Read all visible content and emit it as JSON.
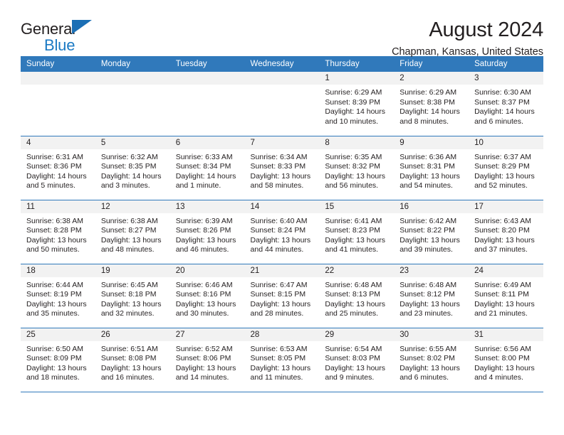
{
  "brand": {
    "line1": "General",
    "line2": "Blue",
    "flag_icon": "triangle-flag-icon",
    "accent_color": "#1b7ac4"
  },
  "header": {
    "month_title": "August 2024",
    "location": "Chapman, Kansas, United States"
  },
  "calendar": {
    "header_bg": "#3079bb",
    "daynum_bg": "#f2f2f2",
    "weekday_headers": [
      "Sunday",
      "Monday",
      "Tuesday",
      "Wednesday",
      "Thursday",
      "Friday",
      "Saturday"
    ],
    "weeks": [
      [
        {
          "day": "",
          "empty": true
        },
        {
          "day": "",
          "empty": true
        },
        {
          "day": "",
          "empty": true
        },
        {
          "day": "",
          "empty": true
        },
        {
          "day": "1",
          "sunrise": "Sunrise: 6:29 AM",
          "sunset": "Sunset: 8:39 PM",
          "daylight": "Daylight: 14 hours and 10 minutes."
        },
        {
          "day": "2",
          "sunrise": "Sunrise: 6:29 AM",
          "sunset": "Sunset: 8:38 PM",
          "daylight": "Daylight: 14 hours and 8 minutes."
        },
        {
          "day": "3",
          "sunrise": "Sunrise: 6:30 AM",
          "sunset": "Sunset: 8:37 PM",
          "daylight": "Daylight: 14 hours and 6 minutes."
        }
      ],
      [
        {
          "day": "4",
          "sunrise": "Sunrise: 6:31 AM",
          "sunset": "Sunset: 8:36 PM",
          "daylight": "Daylight: 14 hours and 5 minutes."
        },
        {
          "day": "5",
          "sunrise": "Sunrise: 6:32 AM",
          "sunset": "Sunset: 8:35 PM",
          "daylight": "Daylight: 14 hours and 3 minutes."
        },
        {
          "day": "6",
          "sunrise": "Sunrise: 6:33 AM",
          "sunset": "Sunset: 8:34 PM",
          "daylight": "Daylight: 14 hours and 1 minute."
        },
        {
          "day": "7",
          "sunrise": "Sunrise: 6:34 AM",
          "sunset": "Sunset: 8:33 PM",
          "daylight": "Daylight: 13 hours and 58 minutes."
        },
        {
          "day": "8",
          "sunrise": "Sunrise: 6:35 AM",
          "sunset": "Sunset: 8:32 PM",
          "daylight": "Daylight: 13 hours and 56 minutes."
        },
        {
          "day": "9",
          "sunrise": "Sunrise: 6:36 AM",
          "sunset": "Sunset: 8:31 PM",
          "daylight": "Daylight: 13 hours and 54 minutes."
        },
        {
          "day": "10",
          "sunrise": "Sunrise: 6:37 AM",
          "sunset": "Sunset: 8:29 PM",
          "daylight": "Daylight: 13 hours and 52 minutes."
        }
      ],
      [
        {
          "day": "11",
          "sunrise": "Sunrise: 6:38 AM",
          "sunset": "Sunset: 8:28 PM",
          "daylight": "Daylight: 13 hours and 50 minutes."
        },
        {
          "day": "12",
          "sunrise": "Sunrise: 6:38 AM",
          "sunset": "Sunset: 8:27 PM",
          "daylight": "Daylight: 13 hours and 48 minutes."
        },
        {
          "day": "13",
          "sunrise": "Sunrise: 6:39 AM",
          "sunset": "Sunset: 8:26 PM",
          "daylight": "Daylight: 13 hours and 46 minutes."
        },
        {
          "day": "14",
          "sunrise": "Sunrise: 6:40 AM",
          "sunset": "Sunset: 8:24 PM",
          "daylight": "Daylight: 13 hours and 44 minutes."
        },
        {
          "day": "15",
          "sunrise": "Sunrise: 6:41 AM",
          "sunset": "Sunset: 8:23 PM",
          "daylight": "Daylight: 13 hours and 41 minutes."
        },
        {
          "day": "16",
          "sunrise": "Sunrise: 6:42 AM",
          "sunset": "Sunset: 8:22 PM",
          "daylight": "Daylight: 13 hours and 39 minutes."
        },
        {
          "day": "17",
          "sunrise": "Sunrise: 6:43 AM",
          "sunset": "Sunset: 8:20 PM",
          "daylight": "Daylight: 13 hours and 37 minutes."
        }
      ],
      [
        {
          "day": "18",
          "sunrise": "Sunrise: 6:44 AM",
          "sunset": "Sunset: 8:19 PM",
          "daylight": "Daylight: 13 hours and 35 minutes."
        },
        {
          "day": "19",
          "sunrise": "Sunrise: 6:45 AM",
          "sunset": "Sunset: 8:18 PM",
          "daylight": "Daylight: 13 hours and 32 minutes."
        },
        {
          "day": "20",
          "sunrise": "Sunrise: 6:46 AM",
          "sunset": "Sunset: 8:16 PM",
          "daylight": "Daylight: 13 hours and 30 minutes."
        },
        {
          "day": "21",
          "sunrise": "Sunrise: 6:47 AM",
          "sunset": "Sunset: 8:15 PM",
          "daylight": "Daylight: 13 hours and 28 minutes."
        },
        {
          "day": "22",
          "sunrise": "Sunrise: 6:48 AM",
          "sunset": "Sunset: 8:13 PM",
          "daylight": "Daylight: 13 hours and 25 minutes."
        },
        {
          "day": "23",
          "sunrise": "Sunrise: 6:48 AM",
          "sunset": "Sunset: 8:12 PM",
          "daylight": "Daylight: 13 hours and 23 minutes."
        },
        {
          "day": "24",
          "sunrise": "Sunrise: 6:49 AM",
          "sunset": "Sunset: 8:11 PM",
          "daylight": "Daylight: 13 hours and 21 minutes."
        }
      ],
      [
        {
          "day": "25",
          "sunrise": "Sunrise: 6:50 AM",
          "sunset": "Sunset: 8:09 PM",
          "daylight": "Daylight: 13 hours and 18 minutes."
        },
        {
          "day": "26",
          "sunrise": "Sunrise: 6:51 AM",
          "sunset": "Sunset: 8:08 PM",
          "daylight": "Daylight: 13 hours and 16 minutes."
        },
        {
          "day": "27",
          "sunrise": "Sunrise: 6:52 AM",
          "sunset": "Sunset: 8:06 PM",
          "daylight": "Daylight: 13 hours and 14 minutes."
        },
        {
          "day": "28",
          "sunrise": "Sunrise: 6:53 AM",
          "sunset": "Sunset: 8:05 PM",
          "daylight": "Daylight: 13 hours and 11 minutes."
        },
        {
          "day": "29",
          "sunrise": "Sunrise: 6:54 AM",
          "sunset": "Sunset: 8:03 PM",
          "daylight": "Daylight: 13 hours and 9 minutes."
        },
        {
          "day": "30",
          "sunrise": "Sunrise: 6:55 AM",
          "sunset": "Sunset: 8:02 PM",
          "daylight": "Daylight: 13 hours and 6 minutes."
        },
        {
          "day": "31",
          "sunrise": "Sunrise: 6:56 AM",
          "sunset": "Sunset: 8:00 PM",
          "daylight": "Daylight: 13 hours and 4 minutes."
        }
      ]
    ]
  }
}
